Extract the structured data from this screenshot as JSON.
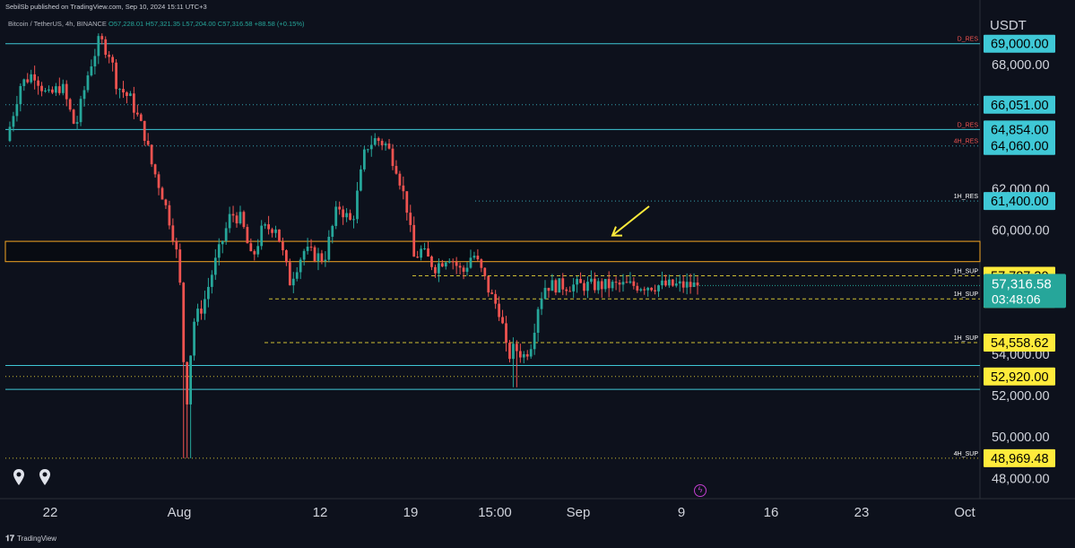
{
  "header": {
    "publisher": "SebilSb published on TradingView.com, Sep 10, 2024 15:11 UTC+3",
    "symbol": "Bitcoin / TetherUS, 4h, BINANCE",
    "ohlc": "O57,228.01 H57,321.35 L57,204.00 C57,316.58 +88.58 (+0.15%)"
  },
  "footer": {
    "brand": "TradingView"
  },
  "colors": {
    "background": "#0d111c",
    "up": "#26a69a",
    "down": "#ef5350",
    "cyan_level": "#3fc8d6",
    "yellow_level": "#ffeb3b",
    "zone": "#f5a623",
    "resistance_text": "#ef5350",
    "support_text": "#ffffff",
    "arrow": "#ffeb3b"
  },
  "chart_data": {
    "type": "candlestick",
    "symbol": "Bitcoin / TetherUS",
    "interval": "4h",
    "exchange": "BINANCE",
    "currency": "USDT",
    "ylim": [
      47500,
      70000
    ],
    "x_ticks": [
      "22",
      "Aug",
      "12",
      "19",
      "15:00",
      "Sep",
      "9",
      "16",
      "23",
      "Oct"
    ],
    "y_ticks": [
      "68,000.00",
      "62,000.00",
      "60,000.00",
      "54,000.00",
      "52,000.00",
      "50,000.00",
      "48,000.00"
    ],
    "horizontal_levels": [
      {
        "price": 69000,
        "label": "D_RES",
        "badge": "69,000.00",
        "color": "cyan",
        "style": "solid"
      },
      {
        "price": 66051,
        "badge": "66,051.00",
        "color": "cyan",
        "style": "dotted"
      },
      {
        "price": 64854,
        "label": "D_RES",
        "badge": "64,854.00",
        "color": "cyan",
        "style": "solid"
      },
      {
        "price": 64060,
        "label": "4H_RES",
        "badge": "64,060.00",
        "color": "cyan",
        "style": "dotted"
      },
      {
        "price": 61400,
        "label": "1H_RES",
        "badge": "61,400.00",
        "color": "cyan",
        "style": "dotted"
      },
      {
        "price": 57787.3,
        "label": "1H_SUP",
        "badge": "57,787.30",
        "color": "yellow",
        "style": "dashed"
      },
      {
        "price": 56670.47,
        "label": "1H_SUP",
        "badge": "56,670.47",
        "color": "yellow",
        "style": "dashed"
      },
      {
        "price": 54558.62,
        "label": "1H_SUP",
        "badge": "54,558.62",
        "color": "yellow",
        "style": "dashed"
      },
      {
        "price": 52920.0,
        "badge": "52,920.00",
        "color": "yellow",
        "style": "dotted"
      },
      {
        "price": 48969.48,
        "label": "4H_SUP",
        "badge": "48,969.48",
        "color": "yellow",
        "style": "dotted"
      }
    ],
    "cyan_lines": [
      53450,
      52300
    ],
    "zone": {
      "high": 59450,
      "low": 58470
    },
    "last_price": {
      "price": 57316.58,
      "label": "57,316.58",
      "countdown": "03:48:06"
    },
    "price_path": [
      [
        0,
        64300
      ],
      [
        0.02,
        67000
      ],
      [
        0.04,
        67600
      ],
      [
        0.06,
        66400
      ],
      [
        0.08,
        67000
      ],
      [
        0.1,
        64900
      ],
      [
        0.12,
        67800
      ],
      [
        0.135,
        69200
      ],
      [
        0.15,
        68500
      ],
      [
        0.16,
        67000
      ],
      [
        0.18,
        66300
      ],
      [
        0.2,
        64600
      ],
      [
        0.21,
        63200
      ],
      [
        0.225,
        61800
      ],
      [
        0.24,
        60000
      ],
      [
        0.25,
        58200
      ],
      [
        0.26,
        51200
      ],
      [
        0.27,
        55500
      ],
      [
        0.285,
        56400
      ],
      [
        0.3,
        58200
      ],
      [
        0.31,
        59200
      ],
      [
        0.325,
        60800
      ],
      [
        0.34,
        60500
      ],
      [
        0.355,
        58500
      ],
      [
        0.37,
        60000
      ],
      [
        0.39,
        60200
      ],
      [
        0.41,
        57500
      ],
      [
        0.43,
        59000
      ],
      [
        0.46,
        58600
      ],
      [
        0.48,
        61200
      ],
      [
        0.5,
        60300
      ],
      [
        0.52,
        64000
      ],
      [
        0.535,
        64400
      ],
      [
        0.55,
        64100
      ],
      [
        0.565,
        63000
      ],
      [
        0.58,
        61000
      ],
      [
        0.59,
        58600
      ],
      [
        0.6,
        59000
      ],
      [
        0.62,
        58200
      ],
      [
        0.64,
        58800
      ],
      [
        0.66,
        57900
      ],
      [
        0.675,
        58900
      ],
      [
        0.69,
        57800
      ],
      [
        0.7,
        56900
      ],
      [
        0.715,
        56000
      ],
      [
        0.725,
        53800
      ],
      [
        0.735,
        54300
      ],
      [
        0.75,
        53900
      ],
      [
        0.76,
        54600
      ],
      [
        0.77,
        56500
      ],
      [
        0.78,
        57317
      ]
    ],
    "price_extremes": {
      "high": 69500,
      "low": 48969
    },
    "annotation": {
      "type": "arrow",
      "color": "yellow",
      "points_to_price": 59600
    }
  }
}
